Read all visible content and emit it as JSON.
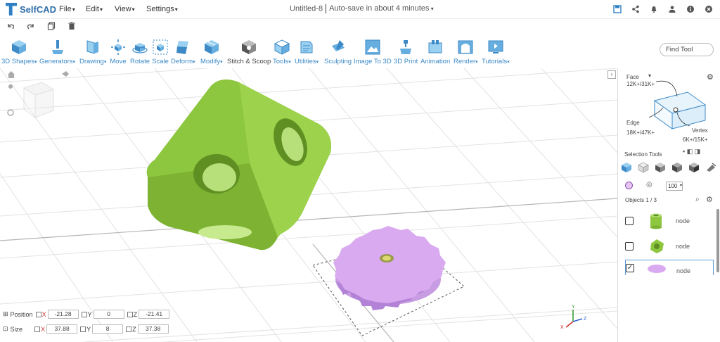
{
  "app": {
    "name": "SelfCAD"
  },
  "menu": [
    "File",
    "Edit",
    "View",
    "Settings"
  ],
  "document": {
    "title": "Untitled-8",
    "autosave": "Auto-save in about 4 minutes"
  },
  "top_icons": [
    "save-icon",
    "share-icon",
    "bell-icon",
    "user-icon",
    "info-icon",
    "close-icon"
  ],
  "toolbar2": [
    "↶",
    "↷",
    "⧉",
    "🗑"
  ],
  "tools": [
    {
      "label": "3D Shapes",
      "dropdown": true
    },
    {
      "label": "Generators",
      "dropdown": true
    },
    {
      "label": "Drawing",
      "dropdown": true
    },
    {
      "label": "Move",
      "dropdown": false
    },
    {
      "label": "Rotate",
      "dropdown": false
    },
    {
      "label": "Scale",
      "dropdown": false
    },
    {
      "label": "Deform",
      "dropdown": true
    },
    {
      "label": "Modify",
      "dropdown": true
    },
    {
      "label": "Stitch & Scoop",
      "dropdown": false
    },
    {
      "label": "Tools",
      "dropdown": true
    },
    {
      "label": "Utilities",
      "dropdown": true
    },
    {
      "label": "Sculpting",
      "dropdown": false
    },
    {
      "label": "Image To 3D",
      "dropdown": false
    },
    {
      "label": "3D Print",
      "dropdown": false
    },
    {
      "label": "Animation",
      "dropdown": false
    },
    {
      "label": "Render",
      "dropdown": true
    },
    {
      "label": "Tutorials",
      "dropdown": true
    }
  ],
  "find_tool": "Find Tool",
  "position": {
    "label": "Position",
    "x": "-21.28",
    "y": "0",
    "z": "-21.41"
  },
  "size": {
    "label": "Size",
    "x": "37.88",
    "y": "8",
    "z": "37.38"
  },
  "axes": {
    "x": "X",
    "y": "Y",
    "z": "Z"
  },
  "side": {
    "face_label": "Face",
    "face_count": "12K+/31K+",
    "edge_label": "Edge",
    "edge_count": "18K+/47K+",
    "vertex_label": "Vertex",
    "vertex_count": "6K+/15K+",
    "selection_tools": "Selection Tools",
    "brush_size": "100",
    "objects_label": "Objects 1 / 3",
    "objects": [
      {
        "name": "node",
        "checked": false,
        "color": "#8dc63f",
        "shape": "cylinder"
      },
      {
        "name": "node",
        "checked": false,
        "color": "#8dc63f",
        "shape": "cube"
      },
      {
        "name": "node",
        "checked": true,
        "color": "#d9aaf0",
        "shape": "gear"
      }
    ]
  },
  "colors": {
    "accent": "#3d8ac7",
    "cube": "#8dc63f",
    "gear": "#d9aaf0",
    "grid": "#e4e4e4"
  }
}
